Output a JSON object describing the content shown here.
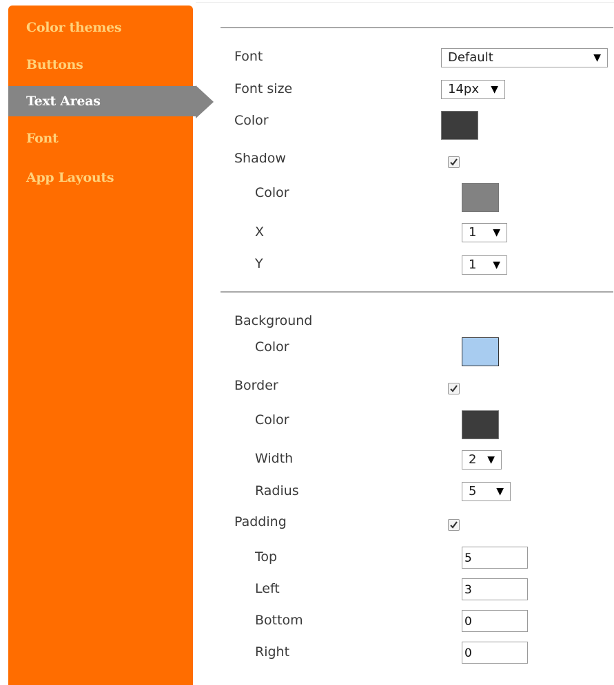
{
  "sidebar": {
    "items": [
      {
        "label": "Color themes"
      },
      {
        "label": "Buttons"
      },
      {
        "label": "Text Areas"
      },
      {
        "label": "Font"
      },
      {
        "label": "App Layouts"
      }
    ],
    "active": "Text Areas"
  },
  "text": {
    "font_label": "Font",
    "font_value": "Default",
    "font_size_label": "Font size",
    "font_size_value": "14px",
    "color_label": "Color",
    "color_value": "#3c3c3c",
    "shadow_label": "Shadow",
    "shadow_checked": true,
    "shadow_color_label": "Color",
    "shadow_color_value": "#828282",
    "shadow_x_label": "X",
    "shadow_x_value": "1",
    "shadow_y_label": "Y",
    "shadow_y_value": "1"
  },
  "background": {
    "label": "Background",
    "color_label": "Color",
    "color_value": "#a8ccf0"
  },
  "border": {
    "label": "Border",
    "checked": true,
    "color_label": "Color",
    "color_value": "#3c3c3c",
    "width_label": "Width",
    "width_value": "2",
    "radius_label": "Radius",
    "radius_value": "5"
  },
  "padding": {
    "label": "Padding",
    "checked": true,
    "top_label": "Top",
    "top_value": "5",
    "left_label": "Left",
    "left_value": "3",
    "bottom_label": "Bottom",
    "bottom_value": "0",
    "right_label": "Right",
    "right_value": "0"
  },
  "colors": {
    "sidebar_bg": "#ff6d00",
    "sidebar_text": "#ffd27a",
    "active_bg": "#858585"
  },
  "icons": {
    "dropdown": "caret-down-icon",
    "checkbox": "checkmark-icon"
  }
}
